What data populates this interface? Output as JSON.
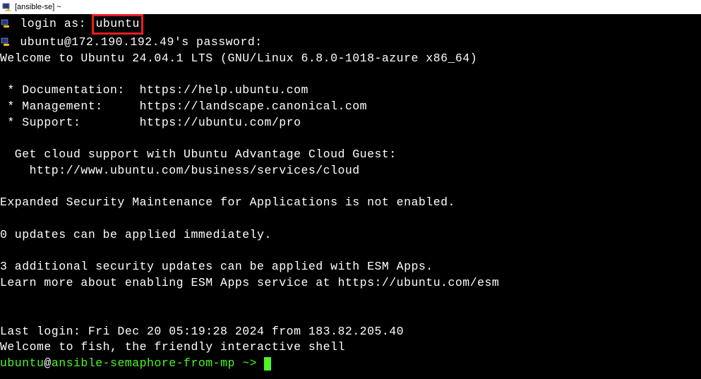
{
  "window": {
    "title": "[ansible-se] ~"
  },
  "login": {
    "prompt": "login as: ",
    "username": "ubuntu",
    "password_prompt": "ubuntu@172.190.192.49's password:"
  },
  "motd": {
    "welcome": "Welcome to Ubuntu 24.04.1 LTS (GNU/Linux 6.8.0-1018-azure x86_64)",
    "links": [
      " * Documentation:  https://help.ubuntu.com",
      " * Management:     https://landscape.canonical.com",
      " * Support:        https://ubuntu.com/pro"
    ],
    "cloud_support_1": "  Get cloud support with Ubuntu Advantage Cloud Guest:",
    "cloud_support_2": "    http://www.ubuntu.com/business/services/cloud",
    "esm_notice": "Expanded Security Maintenance for Applications is not enabled.",
    "updates": "0 updates can be applied immediately.",
    "esm_updates_1": "3 additional security updates can be applied with ESM Apps.",
    "esm_updates_2": "Learn more about enabling ESM Apps service at https://ubuntu.com/esm",
    "last_login": "Last login: Fri Dec 20 05:19:28 2024 from 183.82.205.40",
    "fish_welcome": "Welcome to fish, the friendly interactive shell"
  },
  "prompt": {
    "user": "ubuntu",
    "at": "@",
    "host_path": "ansible-semaphore-from-mp ~> "
  }
}
